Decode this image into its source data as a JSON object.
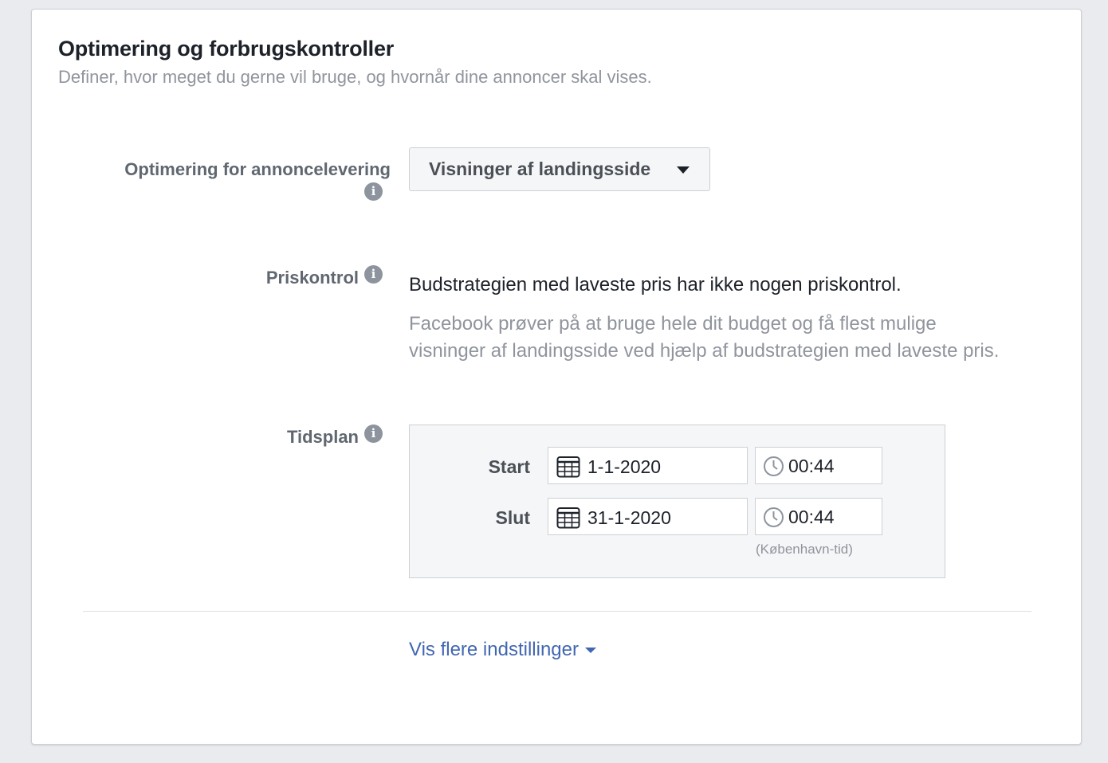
{
  "header": {
    "title": "Optimering og forbrugskontroller",
    "subtitle": "Definer, hvor meget du gerne vil bruge, og hvornår dine annoncer skal vises."
  },
  "optimization": {
    "label": "Optimering for annoncelevering",
    "info_icon": "info-icon",
    "selected_value": "Visninger af landingsside",
    "caret_icon": "caret-down-icon"
  },
  "price_control": {
    "label": "Priskontrol",
    "info_icon": "info-icon",
    "headline": "Budstrategien med laveste pris har ikke nogen priskontrol.",
    "description": "Facebook prøver på at bruge hele dit budget og få flest mulige visninger af landingsside ved hjælp af budstrategien med laveste pris."
  },
  "schedule": {
    "label": "Tidsplan",
    "info_icon": "info-icon",
    "start_label": "Start",
    "start_date": "1-1-2020",
    "start_time": "00:44",
    "end_label": "Slut",
    "end_date": "31-1-2020",
    "end_time": "00:44",
    "timezone_note": "(København-tid)",
    "date_icon": "calendar-icon",
    "time_icon": "clock-icon"
  },
  "more_settings": {
    "label": "Vis flere indstillinger",
    "caret_icon": "caret-down-icon"
  },
  "colors": {
    "link": "#4267b2",
    "title": "#1d2129",
    "muted": "#90949c",
    "label": "#606770",
    "background": "#e9ebee"
  }
}
